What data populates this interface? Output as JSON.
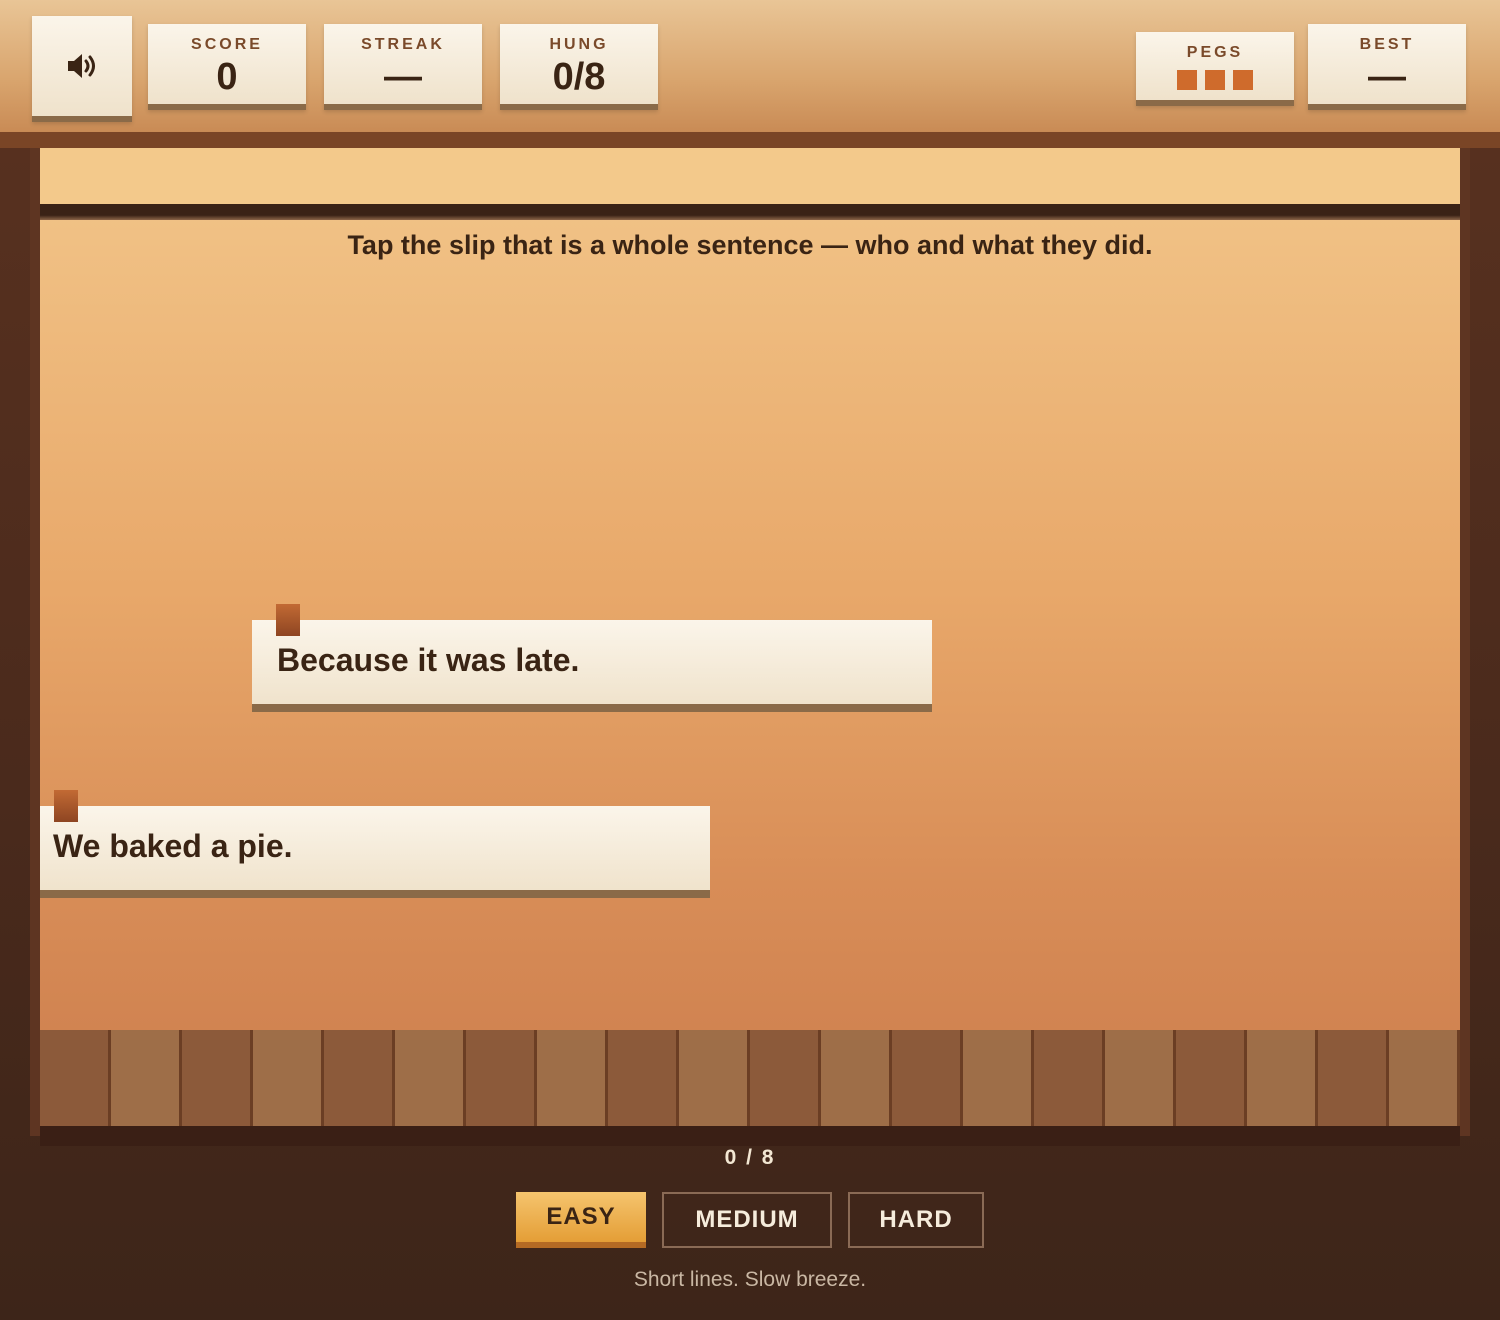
{
  "hud": {
    "sound_icon": "speaker-icon",
    "score": {
      "label": "SCORE",
      "value": "0"
    },
    "streak": {
      "label": "STREAK",
      "value": "—"
    },
    "hung": {
      "label": "HUNG",
      "value": "0/8"
    },
    "pegs": {
      "label": "PEGS",
      "remaining": 3,
      "color": "#cf6b2c"
    },
    "best": {
      "label": "BEST",
      "value": "—"
    }
  },
  "board": {
    "prompt": "Tap the slip that is a whole sentence — who and what they did.",
    "slips": [
      {
        "text": "Because it was late."
      },
      {
        "text": "We baked a pie."
      }
    ]
  },
  "footer": {
    "progress": "0 / 8",
    "difficulty": [
      {
        "label": "EASY",
        "active": true
      },
      {
        "label": "MEDIUM",
        "active": false
      },
      {
        "label": "HARD",
        "active": false
      }
    ],
    "caption": "Short lines. Slow breeze."
  },
  "colors": {
    "accent": "#e49e36",
    "peg": "#cf6b2c",
    "text_dark": "#3a2414"
  }
}
